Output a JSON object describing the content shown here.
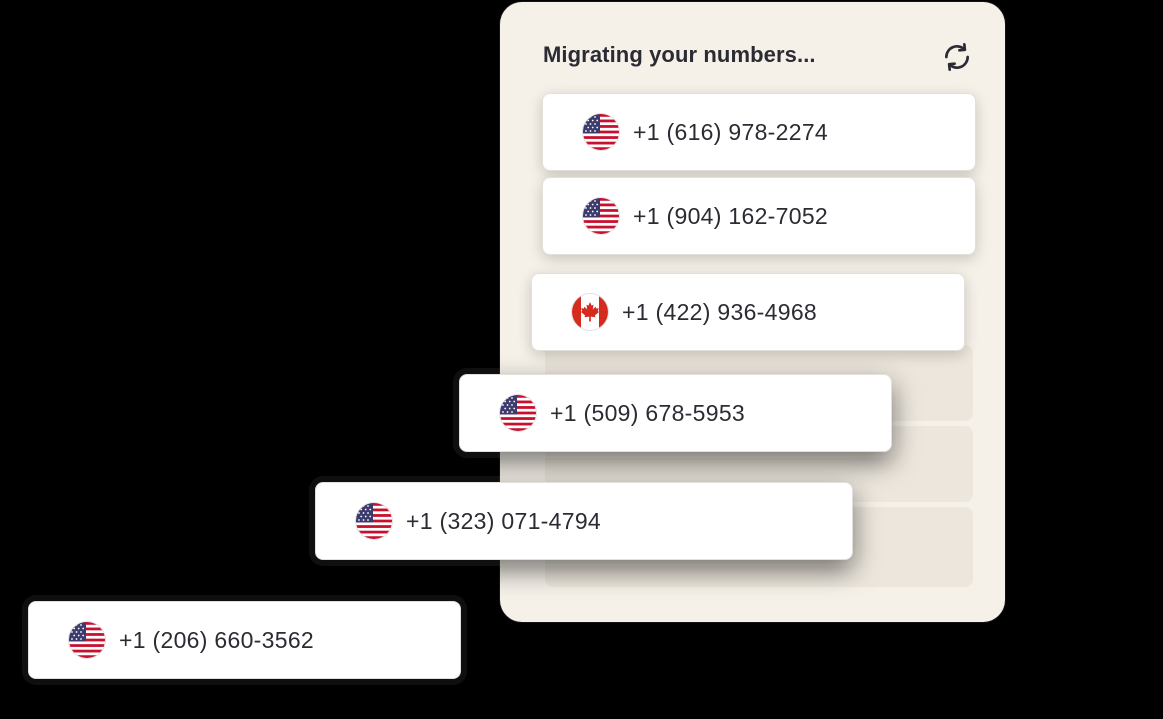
{
  "panel": {
    "title": "Migrating your numbers...",
    "refresh_icon": "refresh-icon"
  },
  "numbers": [
    {
      "number": "+1 (616) 978-2274",
      "flag": "us-flag-icon"
    },
    {
      "number": "+1 (904) 162-7052",
      "flag": "us-flag-icon"
    },
    {
      "number": "+1 (422) 936-4968",
      "flag": "canada-flag-icon"
    },
    {
      "number": "+1 (509) 678-5953",
      "flag": "us-flag-icon"
    },
    {
      "number": "+1 (323) 071-4794",
      "flag": "us-flag-icon"
    },
    {
      "number": "+1 (206) 660-3562",
      "flag": "us-flag-icon"
    }
  ],
  "colors": {
    "panel_background": "#f5f0e8",
    "slot_background": "#ece6dc",
    "card_background": "#ffffff",
    "text": "#2b2b33",
    "page_background": "#000000"
  }
}
